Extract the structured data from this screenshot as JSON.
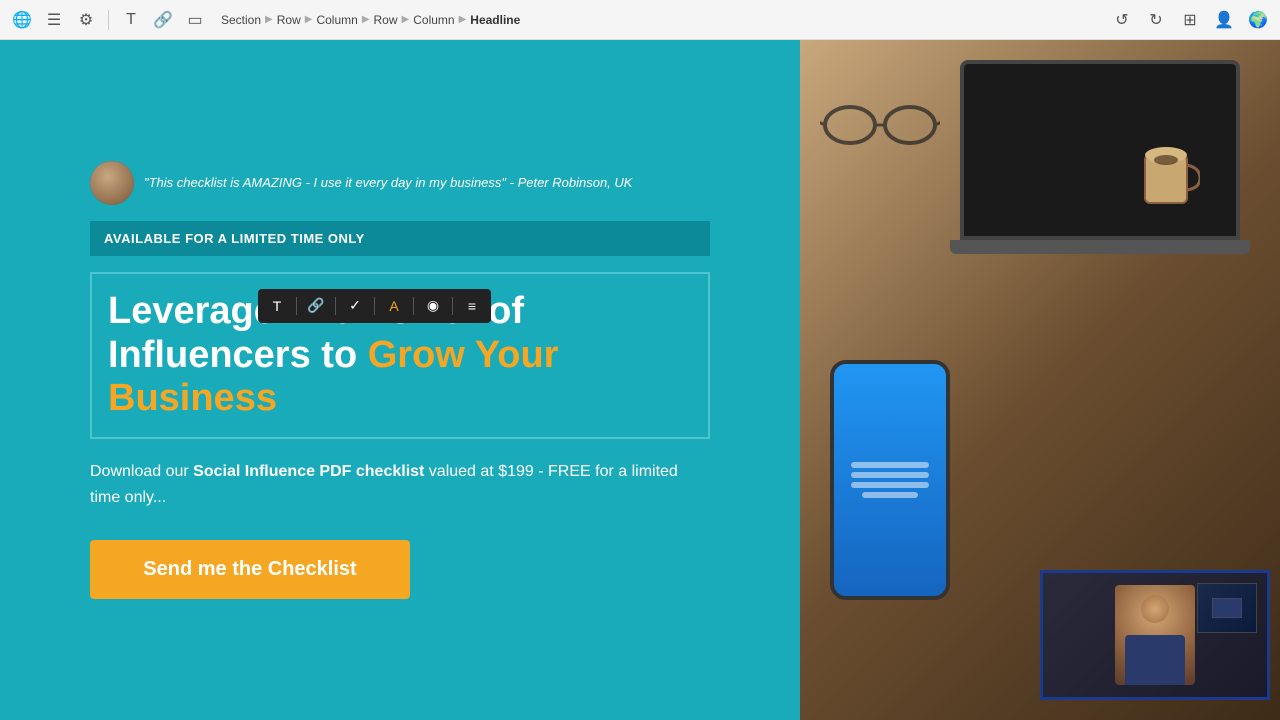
{
  "toolbar": {
    "breadcrumbs": [
      "Section",
      "Row",
      "Column",
      "Row",
      "Column",
      "Headline"
    ],
    "undo_label": "↺",
    "redo_label": "↻"
  },
  "content": {
    "testimonial": "\"This checklist is AMAZING - I use it every day in my business\" - Peter Robinson, UK",
    "banner_text": "AVAILABLE FOR A LIMITED TIME ONLY",
    "headline_white": "Leverage The Power of Influencers to ",
    "headline_orange": "Grow Your Business",
    "description_before": "Download our ",
    "description_bold": "Social Influence PDF checklist",
    "description_after": " valued at $199 - FREE for a limited time only...",
    "cta_button_label": "Send me the Checklist"
  },
  "format_toolbar": {
    "buttons": [
      "T",
      "🔗",
      "✓",
      "A",
      "◉",
      "≡"
    ]
  },
  "colors": {
    "background": "#1aabbb",
    "banner_bg": "#0d8a99",
    "orange": "#f5a623",
    "white": "#ffffff",
    "headline_border": "#4fc3d0"
  }
}
